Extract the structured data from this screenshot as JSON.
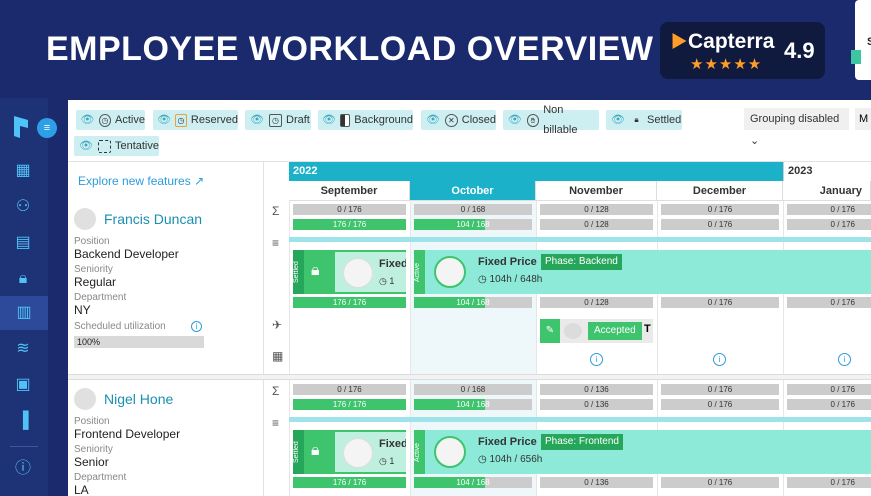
{
  "hero": {
    "title": "EMPLOYEE WORKLOAD OVERVIEW"
  },
  "capterra": {
    "name": "Capterra",
    "rating": "4.9",
    "stars": "★★★★★"
  },
  "corner_badge": {
    "text": "S"
  },
  "filters": [
    {
      "label": "Active",
      "icon": "clock-icon"
    },
    {
      "label": "Reserved",
      "icon": "clock-icon"
    },
    {
      "label": "Draft",
      "icon": "clock-icon"
    },
    {
      "label": "Background",
      "icon": "half-square-icon"
    },
    {
      "label": "Closed",
      "icon": "x-circle-icon"
    },
    {
      "label": "Non billable",
      "icon": "hand-icon"
    },
    {
      "label": "Settled",
      "icon": "lock-icon"
    },
    {
      "label": "Tentative",
      "icon": "dashed-square-icon"
    }
  ],
  "grouping": {
    "label": "Grouping disabled",
    "extra": "M"
  },
  "explore": {
    "label": "Explore new features"
  },
  "timeline": {
    "years": [
      "2022",
      "2023"
    ],
    "months": [
      "September",
      "October",
      "November",
      "December",
      "January"
    ]
  },
  "people": [
    {
      "name": "Francis Duncan",
      "position_label": "Position",
      "position": "Backend Developer",
      "seniority_label": "Seniority",
      "seniority": "Regular",
      "department_label": "Department",
      "department": "NY",
      "util_label": "Scheduled utilization",
      "util": "100%",
      "cap_row": [
        "0 / 176",
        "0 / 168",
        "0 / 128",
        "0 / 176",
        "0 / 176"
      ],
      "load_row": [
        "176 / 176",
        "104 / 168",
        "0 / 128",
        "0 / 176",
        "0 / 176"
      ],
      "proj_row": [
        "176 / 176",
        "104 / 168",
        "0 / 128",
        "0 / 176",
        "0 / 176"
      ],
      "settled_card": {
        "status": "Settled",
        "title": "Fixed",
        "sub": "1"
      },
      "active_card": {
        "status": "Active",
        "title": "Fixed Price",
        "sub": "104h / 648h",
        "phase": "Phase: Backend"
      },
      "accepted": {
        "label": "Accepted",
        "tail": "T"
      }
    },
    {
      "name": "Nigel Hone",
      "position_label": "Position",
      "position": "Frontend Developer",
      "seniority_label": "Seniority",
      "seniority": "Senior",
      "department_label": "Department",
      "department": "LA",
      "cap_row": [
        "0 / 176",
        "0 / 168",
        "0 / 136",
        "0 / 176",
        "0 / 176"
      ],
      "load_row": [
        "176 / 176",
        "104 / 168",
        "0 / 136",
        "0 / 176",
        "0 / 176"
      ],
      "proj_row": [
        "176 / 176",
        "104 / 168",
        "0 / 136",
        "0 / 176",
        "0 / 176"
      ],
      "settled_card": {
        "status": "Settled",
        "title": "Fixed",
        "sub": "1"
      },
      "active_card": {
        "status": "Active",
        "title": "Fixed Price",
        "sub": "104h / 656h",
        "phase": "Phase: Frontend"
      }
    }
  ]
}
